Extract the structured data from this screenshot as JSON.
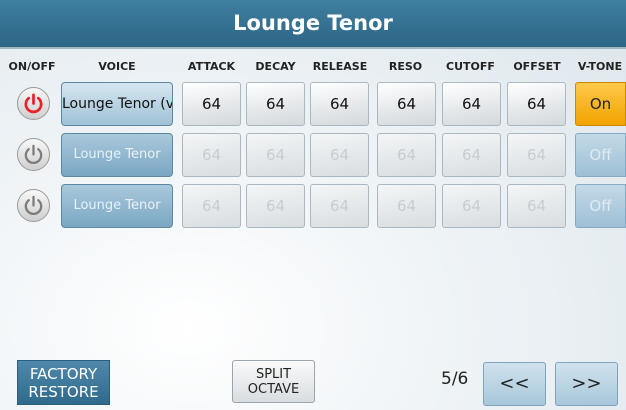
{
  "title": "Lounge Tenor",
  "headers": {
    "onoff": "ON/OFF",
    "voice": "VOICE",
    "attack": "ATTACK",
    "decay": "DECAY",
    "release": "RELEASE",
    "reso": "RESO",
    "cutoff": "CUTOFF",
    "offset": "OFFSET",
    "vtone": "V-TONE"
  },
  "rows": [
    {
      "voice": "Lounge Tenor (v)",
      "attack": "64",
      "decay": "64",
      "release": "64",
      "reso": "64",
      "cutoff": "64",
      "offset": "64",
      "vtone": "On",
      "active": true
    },
    {
      "voice": "Lounge Tenor",
      "attack": "64",
      "decay": "64",
      "release": "64",
      "reso": "64",
      "cutoff": "64",
      "offset": "64",
      "vtone": "Off",
      "active": false
    },
    {
      "voice": "Lounge Tenor",
      "attack": "64",
      "decay": "64",
      "release": "64",
      "reso": "64",
      "cutoff": "64",
      "offset": "64",
      "vtone": "Off",
      "active": false
    }
  ],
  "buttons": {
    "factory_line1": "FACTORY",
    "factory_line2": "RESTORE",
    "split_line1": "SPLIT",
    "split_line2": "OCTAVE",
    "prev": "<<",
    "next": ">>"
  },
  "page": "5/6",
  "colors": {
    "accent": "#2d6585",
    "power_on": "#e8202a",
    "vtone_on": "#f2a300"
  }
}
